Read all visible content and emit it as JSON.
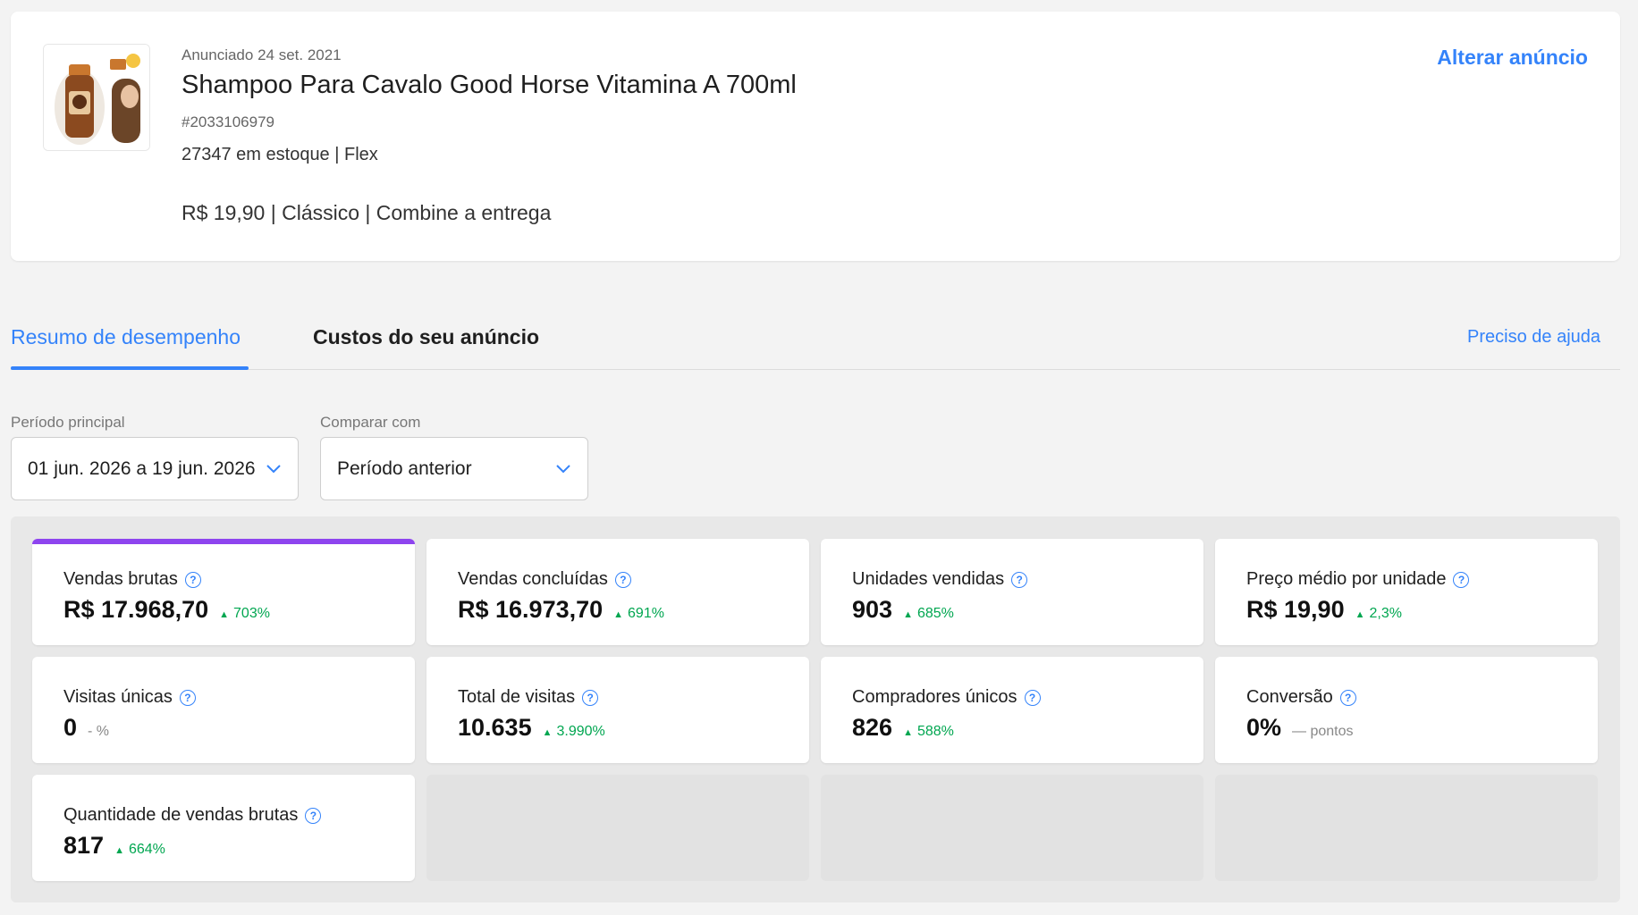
{
  "product": {
    "listed_date": "Anunciado 24 set. 2021",
    "title": "Shampoo Para Cavalo Good Horse Vitamina A 700ml",
    "id": "#2033106979",
    "stock": "27347 em estoque | Flex",
    "price_line": "R$ 19,90 | Clássico | Combine a entrega",
    "edit_label": "Alterar anúncio",
    "thumbnail_icon": "product-image"
  },
  "tabs": {
    "active": "Resumo de desempenho",
    "costs": "Custos do seu anúncio",
    "help": "Preciso de ajuda"
  },
  "filters": {
    "period_label": "Período principal",
    "period_value": "01 jun. 2026 a 19 jun. 2026",
    "compare_label": "Comparar com",
    "compare_value": "Período anterior"
  },
  "metrics": [
    {
      "label": "Vendas brutas",
      "value": "R$ 17.968,70",
      "delta": "703%",
      "trend": "up"
    },
    {
      "label": "Vendas concluídas",
      "value": "R$ 16.973,70",
      "delta": "691%",
      "trend": "up"
    },
    {
      "label": "Unidades vendidas",
      "value": "903",
      "delta": "685%",
      "trend": "up"
    },
    {
      "label": "Preço médio por unidade",
      "value": "R$ 19,90",
      "delta": "2,3%",
      "trend": "up"
    },
    {
      "label": "Visitas únicas",
      "value": "0",
      "delta": "- %",
      "trend": "neutral"
    },
    {
      "label": "Total de visitas",
      "value": "10.635",
      "delta": "3.990%",
      "trend": "up"
    },
    {
      "label": "Compradores únicos",
      "value": "826",
      "delta": "588%",
      "trend": "up"
    },
    {
      "label": "Conversão",
      "value": "0%",
      "delta": "— pontos",
      "trend": "neutral"
    },
    {
      "label": "Quantidade de vendas brutas",
      "value": "817",
      "delta": "664%",
      "trend": "up"
    }
  ],
  "colors": {
    "accent": "#3483fa",
    "positive": "#00a650",
    "selected_card": "#8e44ef"
  }
}
